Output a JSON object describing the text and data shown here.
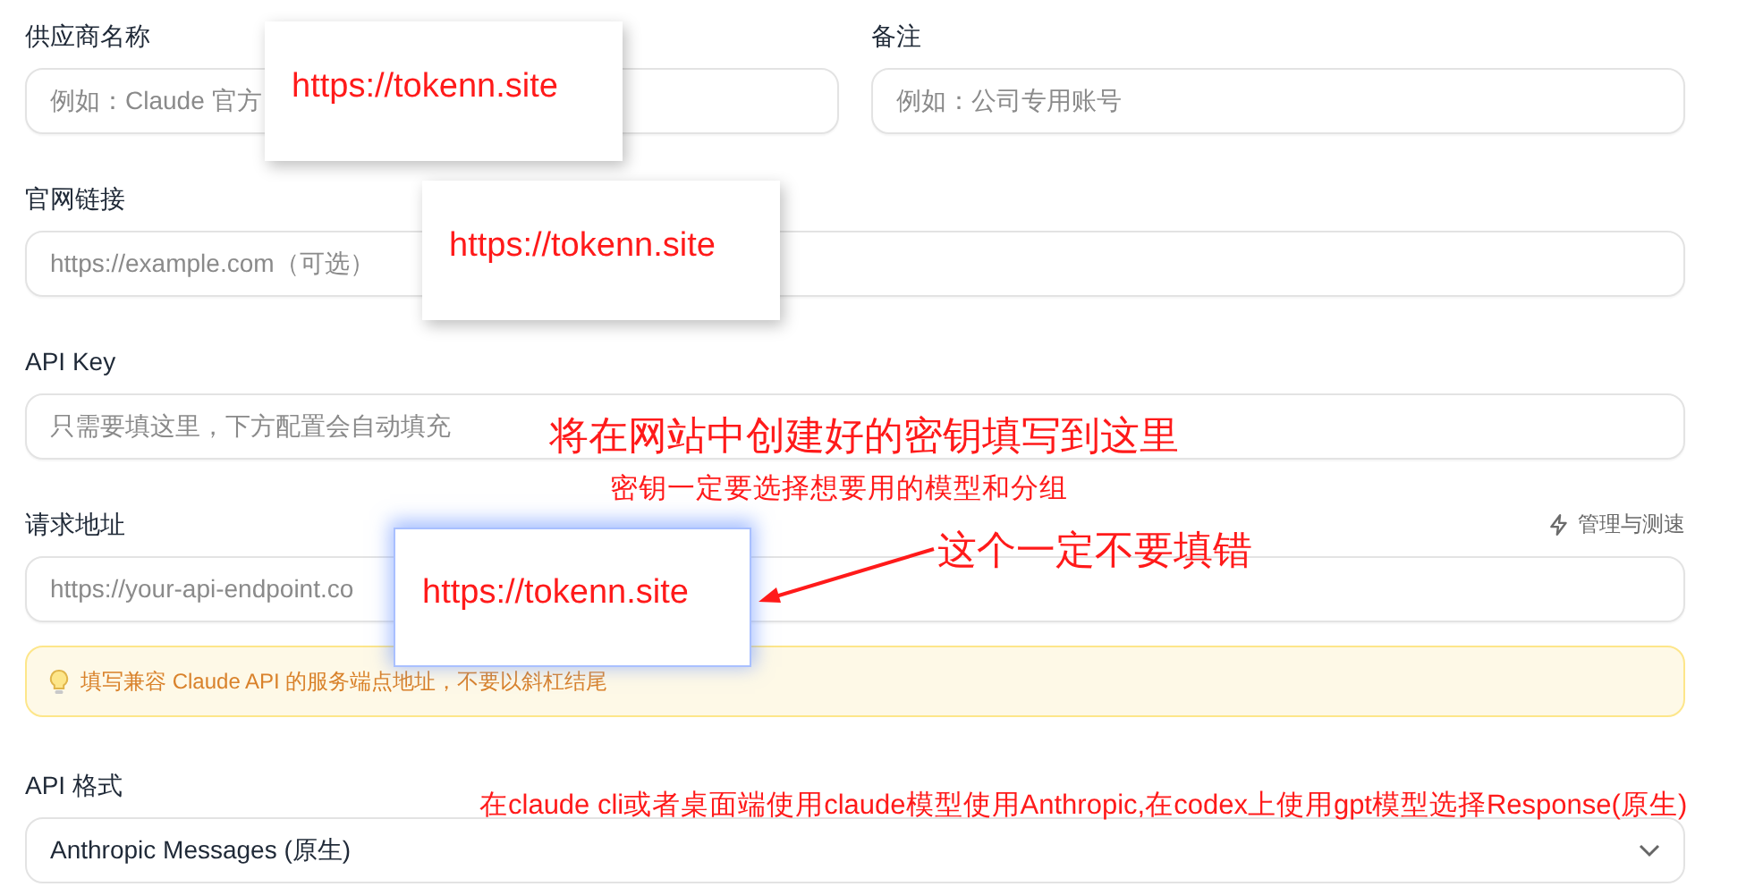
{
  "form": {
    "top_row": [
      {
        "label": "供应商名称",
        "placeholder": "例如：Claude 官方"
      },
      {
        "label": "备注",
        "placeholder": "例如：公司专用账号"
      }
    ],
    "website": {
      "label": "官网链接",
      "placeholder": "https://example.com（可选）"
    },
    "api_key": {
      "label": "API Key",
      "placeholder": "只需要填这里，下方配置会自动填充"
    },
    "endpoint": {
      "label": "请求地址",
      "action": "管理与测速",
      "placeholder": "https://your-api-endpoint.co",
      "hint": "填写兼容 Claude API 的服务端点地址，不要以斜杠结尾"
    },
    "api_format": {
      "label": "API 格式",
      "value": "Anthropic Messages (原生)"
    }
  },
  "annotations": {
    "url_boxes": [
      {
        "text": "https://tokenn.site",
        "highlighted": false
      },
      {
        "text": "https://tokenn.site",
        "highlighted": false
      },
      {
        "text": "https://tokenn.site",
        "highlighted": true
      }
    ],
    "notes": [
      {
        "text": "将在网站中创建好的密钥填写到这里",
        "kind": "large"
      },
      {
        "text": "密钥一定要选择想要用的模型和分组",
        "kind": "small"
      },
      {
        "text": "这个一定不要填错",
        "kind": "large"
      },
      {
        "text": "在claude cli或者桌面端使用claude模型使用Anthropic,在codex上使用gpt模型选择Response(原生)",
        "kind": "small"
      }
    ]
  }
}
